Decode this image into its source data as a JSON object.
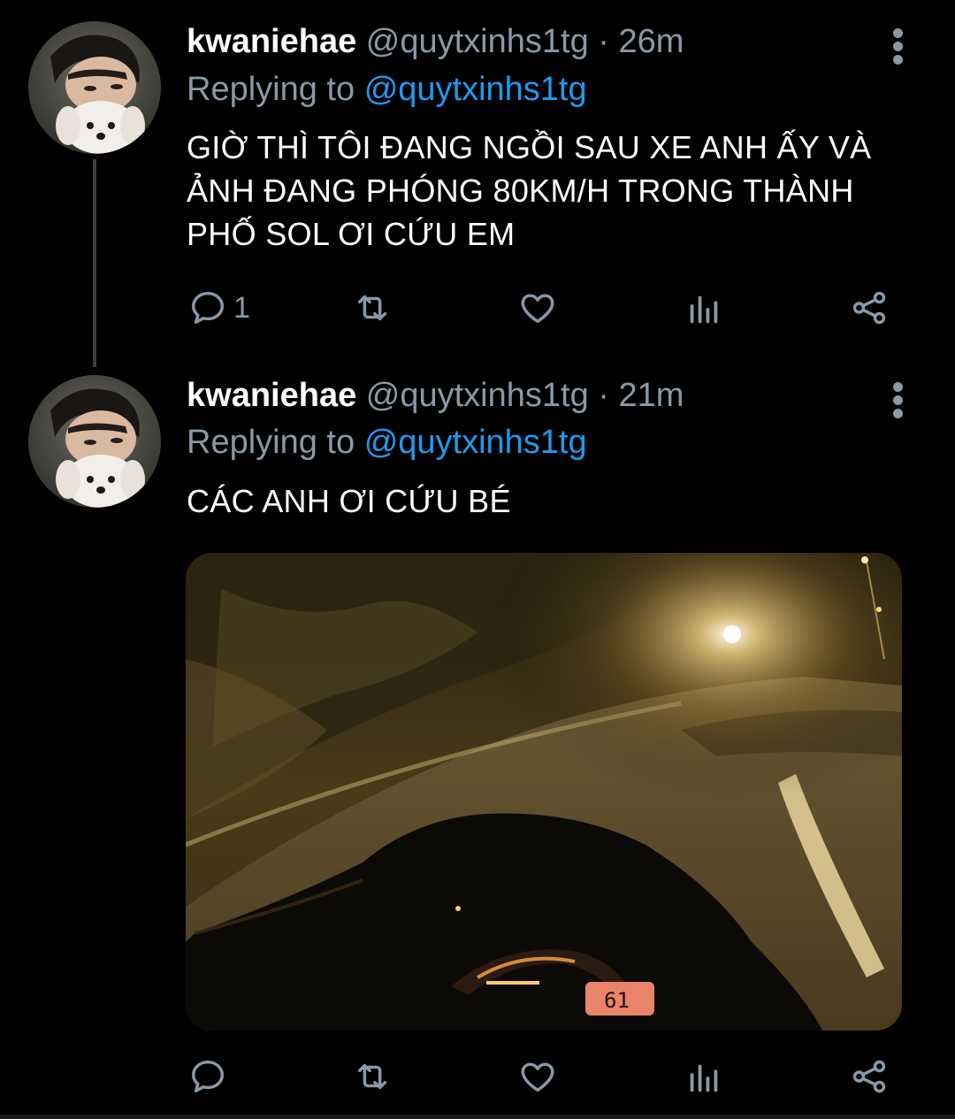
{
  "colors": {
    "background": "#000000",
    "secondary_text": "#8b98a5",
    "link": "#1d9bf0",
    "primary_text": "#ffffff"
  },
  "tweets": [
    {
      "display_name": "kwaniehae",
      "handle": "@quytxinhs1tg",
      "separator": "·",
      "time": "26m",
      "replying_label": "Replying to",
      "replying_handle": "@quytxinhs1tg",
      "text": "GIỜ THÌ TÔI ĐANG NGỒI SAU XE ANH ẤY VÀ ẢNH ĐANG PHÓNG 80KM/H TRONG THÀNH PHỐ SOL ƠI CỨU EM",
      "reply_count": "1",
      "icons": [
        "reply-icon",
        "retweet-icon",
        "like-icon",
        "analytics-icon",
        "share-icon",
        "more-options-icon"
      ]
    },
    {
      "display_name": "kwaniehae",
      "handle": "@quytxinhs1tg",
      "separator": "·",
      "time": "21m",
      "replying_label": "Replying to",
      "replying_handle": "@quytxinhs1tg",
      "text": "CÁC ANH ƠI CỨU BÉ",
      "reply_count": "",
      "speedometer_reading": "61",
      "icons": [
        "reply-icon",
        "retweet-icon",
        "like-icon",
        "analytics-icon",
        "share-icon",
        "more-options-icon"
      ]
    }
  ]
}
